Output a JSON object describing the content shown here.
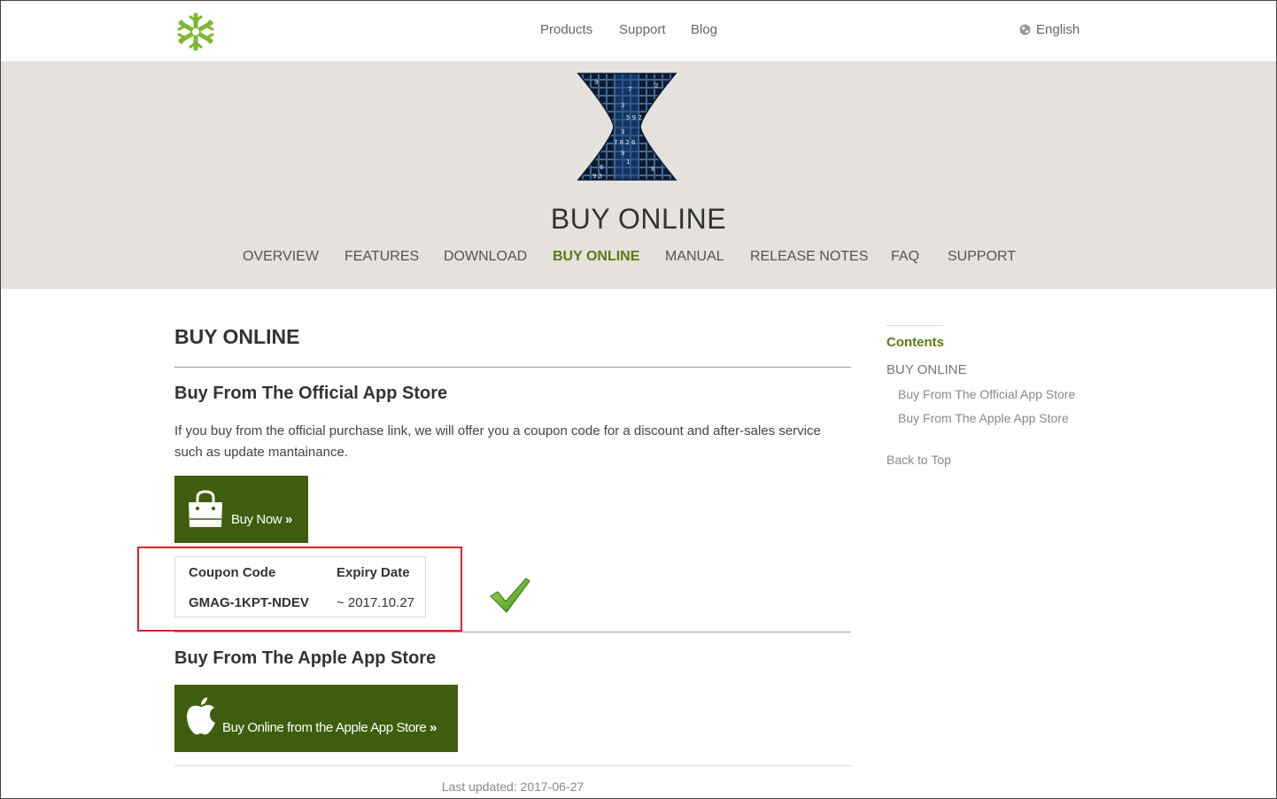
{
  "header": {
    "nav": [
      "Products",
      "Support",
      "Blog"
    ],
    "language": "English"
  },
  "banner": {
    "title": "BUY ONLINE",
    "tabs": [
      "OVERVIEW",
      "FEATURES",
      "DOWNLOAD",
      "BUY ONLINE",
      "MANUAL",
      "RELEASE NOTES",
      "FAQ",
      "SUPPORT"
    ],
    "active_tab": "BUY ONLINE"
  },
  "main": {
    "title": "BUY ONLINE",
    "section1": {
      "heading": "Buy From The Official App Store",
      "text": "If you buy from the official purchase link, we will offer you a coupon code for a discount and after-sales service such as update mantainance.",
      "button_label": "Buy Now"
    },
    "coupon": {
      "headers": [
        "Coupon Code",
        "Expiry Date"
      ],
      "code": "GMAG-1KPT-NDEV",
      "expiry": "~ 2017.10.27"
    },
    "section2": {
      "heading": "Buy From The Apple App Store",
      "button_label": "Buy Online from the Apple App Store"
    },
    "last_updated": "Last updated: 2017-06-27"
  },
  "sidebar": {
    "title": "Contents",
    "items": [
      {
        "label": "BUY ONLINE",
        "level": 1
      },
      {
        "label": "Buy From The Official App Store",
        "level": 2
      },
      {
        "label": "Buy From The Apple App Store",
        "level": 2
      }
    ],
    "back_to_top": "Back to Top"
  },
  "colors": {
    "accent": "#5b7a12",
    "button": "#3f5d0e",
    "banner_bg": "#e5e1dc",
    "highlight_box": "#e0232b"
  },
  "icons": [
    "snowflake-logo",
    "globe-icon",
    "hourglass-logo",
    "shopping-bag-icon",
    "apple-icon",
    "checkmark-icon",
    "double-chevron-right-icon"
  ]
}
